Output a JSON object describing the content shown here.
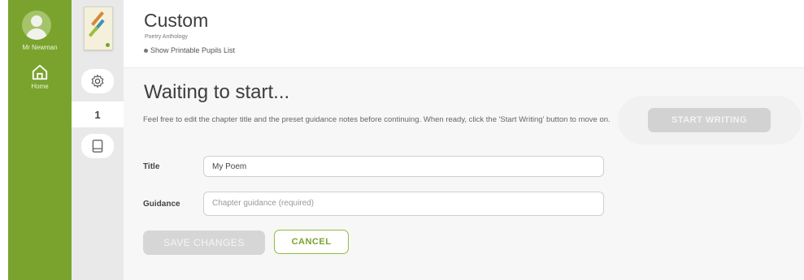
{
  "sidebar": {
    "user_name": "Mr Newman",
    "home_label": "Home",
    "chapter_number": "1"
  },
  "header": {
    "title": "Custom",
    "subtitle": "Poetry Anthology",
    "printable_link": "Show Printable Pupils List"
  },
  "main": {
    "heading": "Waiting to start...",
    "description": "Feel free to edit the chapter title and the preset guidance notes before continuing. When ready, click the 'Start Writing' button to move on.",
    "title_label": "Title",
    "title_value": "My Poem",
    "guidance_label": "Guidance",
    "guidance_placeholder": "Chapter guidance (required)",
    "save_label": "SAVE CHANGES",
    "cancel_label": "CANCEL",
    "start_label": "START WRITING"
  },
  "icons": {
    "avatar": "user-avatar-icon",
    "home": "home-icon",
    "settings": "gear-icon",
    "notes": "document-icon"
  },
  "colors": {
    "accent": "#7aa32e",
    "tool_column": "#e9e9e9",
    "disabled_button": "#d6d6d6"
  }
}
